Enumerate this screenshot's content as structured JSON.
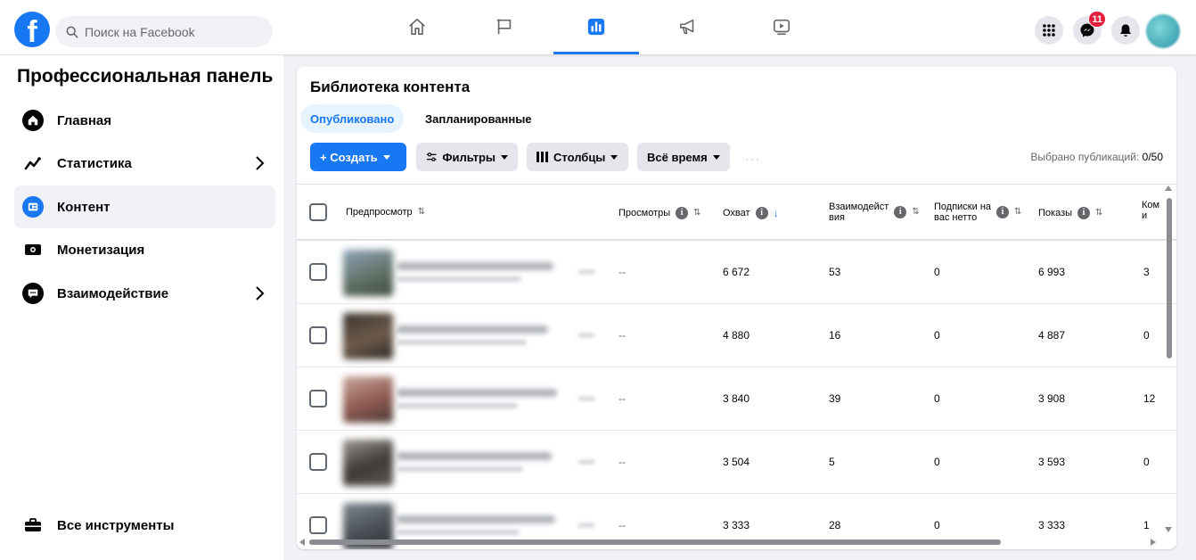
{
  "topbar": {
    "search_placeholder": "Поиск на Facebook",
    "messenger_badge": "11",
    "logo_glyph": "f"
  },
  "sidebar": {
    "title": "Профессиональная панель",
    "items": [
      {
        "label": "Главная",
        "icon": "home-icon"
      },
      {
        "label": "Статистика",
        "icon": "trend-icon",
        "has_chevron": true
      },
      {
        "label": "Контент",
        "icon": "content-icon",
        "active": true
      },
      {
        "label": "Монетизация",
        "icon": "money-icon"
      },
      {
        "label": "Взаимодействие",
        "icon": "chat-icon",
        "has_chevron": true
      }
    ],
    "all_tools": "Все инструменты"
  },
  "panel": {
    "title": "Библиотека контента",
    "tabs": [
      "Опубликовано",
      "Запланированные"
    ],
    "buttons": {
      "create": "+ Создать",
      "filters": "Фильтры",
      "columns": "Столбцы",
      "period": "Всё время"
    },
    "selected_label": "Выбрано публикаций:",
    "selected_value": "0/50"
  },
  "table": {
    "headers": {
      "preview": "Предпросмотр",
      "views": "Просмотры",
      "reach": "Охват",
      "engagement_1": "Взаимодейст",
      "engagement_2": "вия",
      "follows_1": "Подписки на",
      "follows_2": "вас нетто",
      "impressions": "Показы",
      "comments_1": "Ком",
      "comments_2": "и"
    },
    "rows": [
      {
        "views": "--",
        "reach": "6 672",
        "engagement": "53",
        "follows": "0",
        "impressions": "6 993",
        "comments": "3"
      },
      {
        "views": "--",
        "reach": "4 880",
        "engagement": "16",
        "follows": "0",
        "impressions": "4 887",
        "comments": "0"
      },
      {
        "views": "--",
        "reach": "3 840",
        "engagement": "39",
        "follows": "0",
        "impressions": "3 908",
        "comments": "12"
      },
      {
        "views": "--",
        "reach": "3 504",
        "engagement": "5",
        "follows": "0",
        "impressions": "3 593",
        "comments": "0"
      },
      {
        "views": "--",
        "reach": "3 333",
        "engagement": "28",
        "follows": "0",
        "impressions": "3 333",
        "comments": "1"
      }
    ]
  },
  "colors": {
    "brand_blue": "#1877f2",
    "badge_red": "#e41e3f",
    "page_bg": "#f0f2f5"
  }
}
